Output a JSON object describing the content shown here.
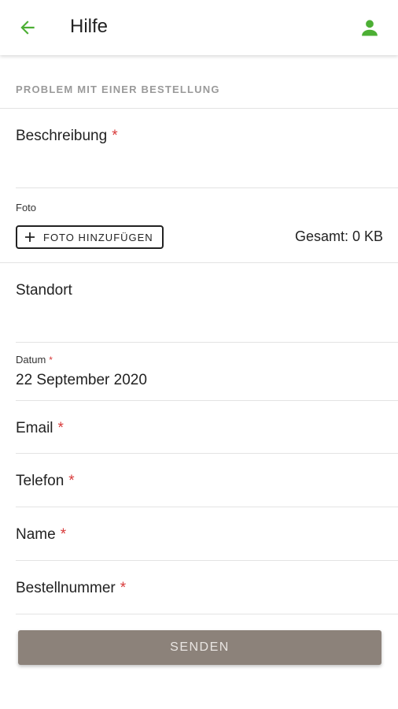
{
  "colors": {
    "accent": "#4caf34",
    "required": "#d83a3a",
    "button": "#8c827a"
  },
  "appbar": {
    "title": "Hilfe",
    "back_icon": "arrow-left",
    "account_icon": "person"
  },
  "section": {
    "title": "PROBLEM MIT EINER BESTELLUNG"
  },
  "form": {
    "beschreibung": {
      "label": "Beschreibung",
      "required": "*"
    },
    "foto": {
      "label": "Foto",
      "button_label": "FOTO HINZUFÜGEN",
      "total": "Gesamt: 0 KB"
    },
    "standort": {
      "label": "Standort"
    },
    "datum": {
      "label": "Datum",
      "required": "*",
      "value": "22 September 2020"
    },
    "email": {
      "label": "Email",
      "required": "*"
    },
    "telefon": {
      "label": "Telefon",
      "required": "*"
    },
    "name": {
      "label": "Name",
      "required": "*"
    },
    "bestellnummer": {
      "label": "Bestellnummer",
      "required": "*"
    }
  },
  "submit": {
    "label": "SENDEN"
  }
}
